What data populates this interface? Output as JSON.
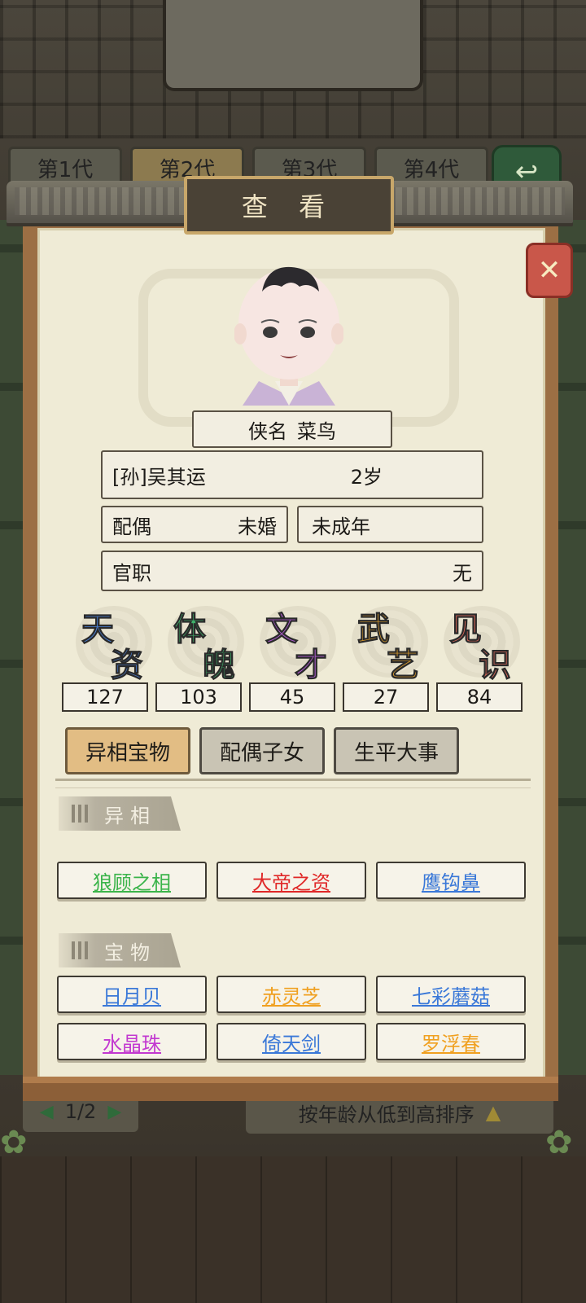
{
  "background": {
    "generation_tabs": [
      "第1代",
      "第2代",
      "第3代",
      "第4代"
    ],
    "page_indicator": "1/2",
    "sort_label": "按年龄从低到高排序"
  },
  "dialog": {
    "title": "查看",
    "title_display": "查 看",
    "close_icon": "close-x-icon"
  },
  "character": {
    "xiaming_label": "侠名",
    "xiaming_value": "菜鸟",
    "full_name": "[孙]吴其运",
    "age": "2岁",
    "spouse_label": "配偶",
    "spouse_value": "未婚",
    "adult_status": "未成年",
    "office_label": "官职",
    "office_value": "无"
  },
  "stats": [
    {
      "c1": "天",
      "c2": "资",
      "value": "127",
      "color": "#4a7fd4"
    },
    {
      "c1": "体",
      "c2": "魄",
      "value": "103",
      "color": "#3fb06a"
    },
    {
      "c1": "文",
      "c2": "才",
      "value": "45",
      "color": "#b05cd0"
    },
    {
      "c1": "武",
      "c2": "艺",
      "value": "27",
      "color": "#e6a32c"
    },
    {
      "c1": "见",
      "c2": "识",
      "value": "84",
      "color": "#e06a5a"
    }
  ],
  "tabs": [
    "异相宝物",
    "配偶子女",
    "生平大事"
  ],
  "sections": {
    "yixiang_title": "异相",
    "yixiang": [
      {
        "label": "狼顾之相",
        "color": "#3bb44a"
      },
      {
        "label": "大帝之资",
        "color": "#e02828"
      },
      {
        "label": "鹰钩鼻",
        "color": "#3a78d8"
      }
    ],
    "baowu_title": "宝物",
    "baowu": [
      {
        "label": "日月贝",
        "color": "#3a78d8"
      },
      {
        "label": "赤灵芝",
        "color": "#f0a020"
      },
      {
        "label": "七彩蘑菇",
        "color": "#3a78d8"
      },
      {
        "label": "水晶珠",
        "color": "#c238d0"
      },
      {
        "label": "倚天剑",
        "color": "#3a78d8"
      },
      {
        "label": "罗浮春",
        "color": "#f0a020"
      }
    ]
  }
}
